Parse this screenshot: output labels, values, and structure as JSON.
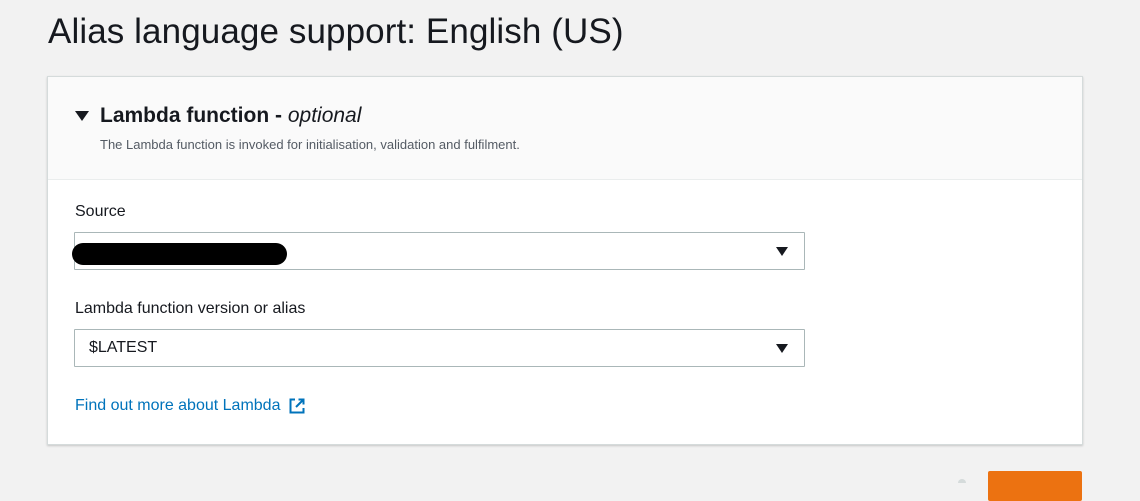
{
  "page": {
    "title": "Alias language support: English (US)"
  },
  "lambda_section": {
    "title": "Lambda function -",
    "optional_label": "optional",
    "description": "The Lambda function is invoked for initialisation, validation and fulfilment.",
    "source": {
      "label": "Source",
      "value": "",
      "redacted": true
    },
    "version": {
      "label": "Lambda function version or alias",
      "value": "$LATEST"
    },
    "learn_more_link": "Find out more about Lambda"
  },
  "icons": {
    "collapse": "caret-down-icon",
    "dropdown": "chevron-down-icon",
    "external_link": "external-link-icon"
  },
  "colors": {
    "link": "#0073bb",
    "primary_button": "#ec7211",
    "panel_header_bg": "#fafafa",
    "page_bg": "#f2f2f2"
  }
}
